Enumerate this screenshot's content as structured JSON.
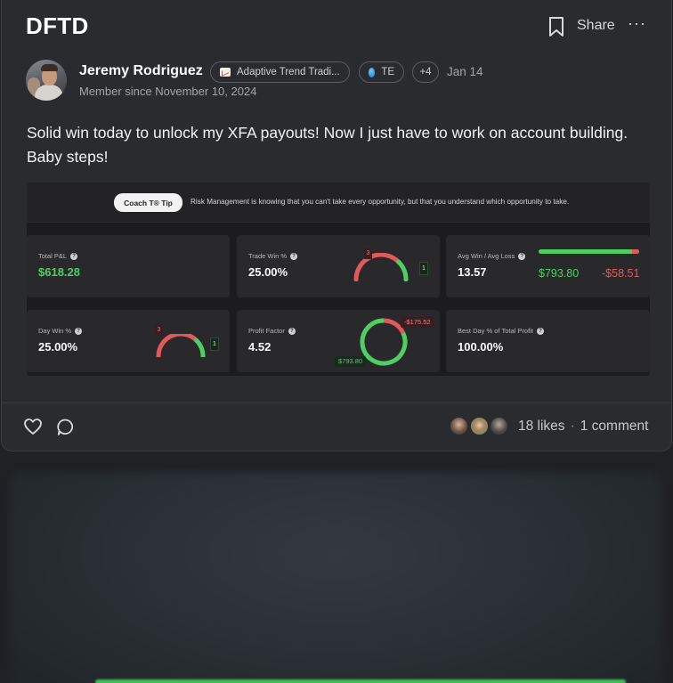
{
  "post": {
    "title": "DFTD",
    "share_label": "Share",
    "more_label": "···",
    "author": {
      "name": "Jeremy Rodriguez",
      "member_since": "Member since November 10, 2024"
    },
    "tags": [
      {
        "label": "Adaptive Trend Tradi...",
        "icon": "chart-icon"
      },
      {
        "label": "TE",
        "icon": "globe-icon"
      },
      {
        "label": "+4"
      }
    ],
    "date": "Jan 14",
    "text": "Solid win today to unlock my XFA payouts! Now I just have to work on account building. Baby steps!"
  },
  "dashboard": {
    "coach_label": "Coach T® Tip",
    "tip_text": "Risk Management is knowing that you can't take every opportunity, but that you understand which opportunity to take.",
    "tiles": {
      "total_pnl": {
        "label": "Total P&L",
        "value": "$618.28"
      },
      "trade_win": {
        "label": "Trade Win %",
        "value": "25.00%",
        "losses": "3",
        "wins": "1",
        "win_fraction": 0.25
      },
      "avg_win_loss": {
        "label": "Avg Win / Avg Loss",
        "value": "13.57",
        "avg_win": "$793.80",
        "avg_loss": "-$58.51"
      },
      "day_win": {
        "label": "Day Win %",
        "value": "25.00%",
        "losses": "3",
        "wins": "1",
        "win_fraction": 0.25
      },
      "profit_factor": {
        "label": "Profit Factor",
        "value": "4.52",
        "gross_loss": "-$175.52",
        "gross_profit": "$793.80"
      },
      "best_day": {
        "label": "Best Day % of Total Profit",
        "value": "100.00%"
      }
    },
    "colors": {
      "green": "#4fcf63",
      "red": "#e05a5a"
    }
  },
  "footer": {
    "likes": "18 likes",
    "separator": "·",
    "comments": "1 comment"
  }
}
